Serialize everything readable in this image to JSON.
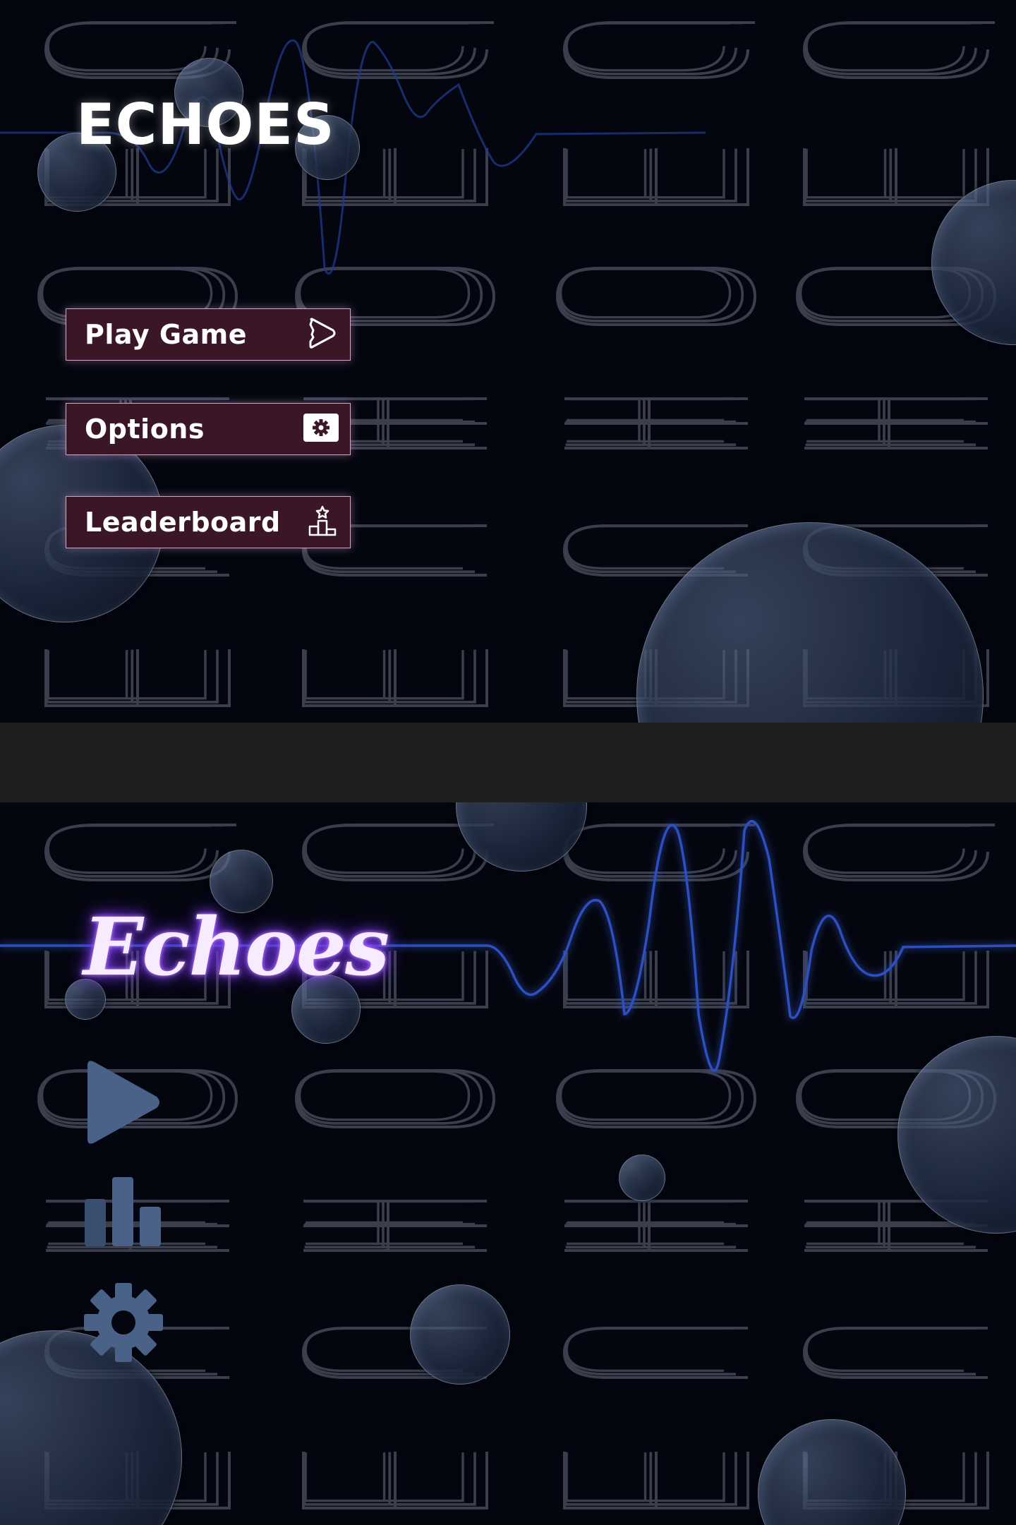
{
  "top_menu": {
    "title": "ECHOES",
    "buttons": [
      {
        "label": "Play Game",
        "icon": "play-outline-icon"
      },
      {
        "label": "Options",
        "icon": "gear-icon"
      },
      {
        "label": "Leaderboard",
        "icon": "podium-icon"
      }
    ],
    "colors": {
      "button_fill": "#3a1626",
      "button_border": "#c9a9c6",
      "title": "#ffffff"
    }
  },
  "bottom_menu": {
    "title": "Echoes",
    "icon_buttons": [
      {
        "icon": "play-icon"
      },
      {
        "icon": "bar-chart-icon"
      },
      {
        "icon": "gear-icon"
      }
    ],
    "colors": {
      "neon_title": "#c58bff",
      "icon": "#4a6288",
      "waveform": "#2f4fc0"
    }
  },
  "colors": {
    "background": "#04060f",
    "divider": "#1f1f20",
    "background_letters": "#3b3f4d"
  }
}
